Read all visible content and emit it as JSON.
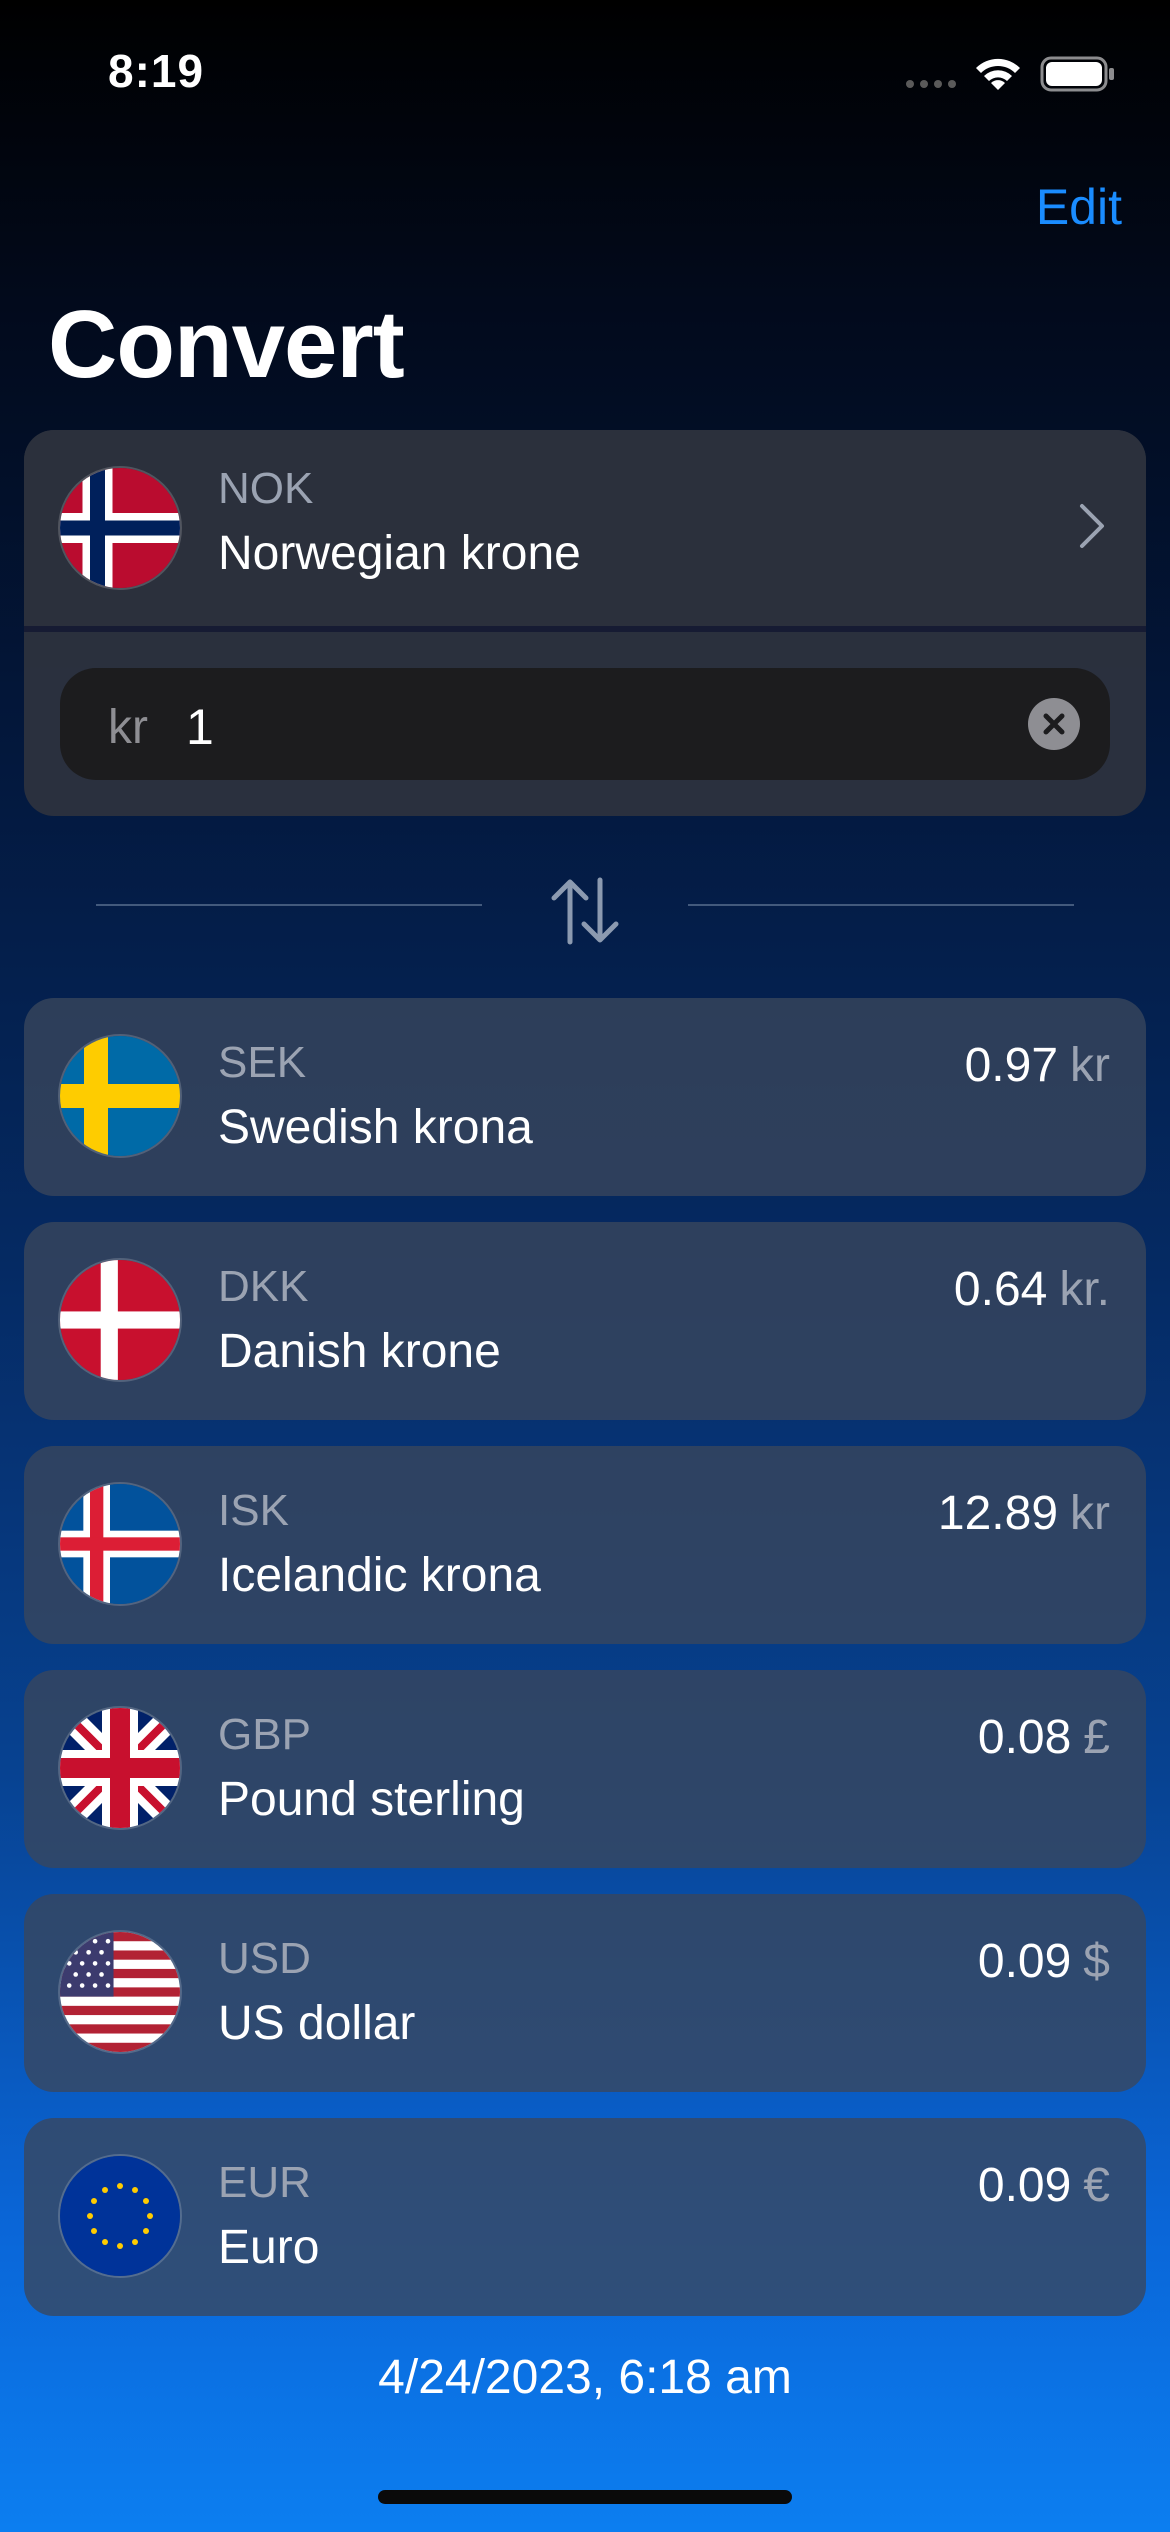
{
  "status_bar": {
    "time": "8:19"
  },
  "nav": {
    "edit_label": "Edit",
    "title": "Convert"
  },
  "source": {
    "code": "NOK",
    "name": "Norwegian krone",
    "flag_icon": "norway-flag-icon",
    "amount_symbol": "kr",
    "amount_value": "1"
  },
  "rates": [
    {
      "code": "SEK",
      "name": "Swedish krona",
      "value": "0.97",
      "symbol": "kr",
      "flag_icon": "sweden-flag-icon"
    },
    {
      "code": "DKK",
      "name": "Danish krone",
      "value": "0.64",
      "symbol": "kr.",
      "flag_icon": "denmark-flag-icon"
    },
    {
      "code": "ISK",
      "name": "Icelandic krona",
      "value": "12.89",
      "symbol": "kr",
      "flag_icon": "iceland-flag-icon"
    },
    {
      "code": "GBP",
      "name": "Pound sterling",
      "value": "0.08",
      "symbol": "£",
      "flag_icon": "uk-flag-icon"
    },
    {
      "code": "USD",
      "name": "US dollar",
      "value": "0.09",
      "symbol": "$",
      "flag_icon": "us-flag-icon"
    },
    {
      "code": "EUR",
      "name": "Euro",
      "value": "0.09",
      "symbol": "€",
      "flag_icon": "eu-flag-icon"
    }
  ],
  "footer": {
    "timestamp": "4/24/2023, 6:18 am"
  },
  "colors": {
    "accent": "#1a8cff",
    "secondary_text": "#9ba3b2"
  }
}
